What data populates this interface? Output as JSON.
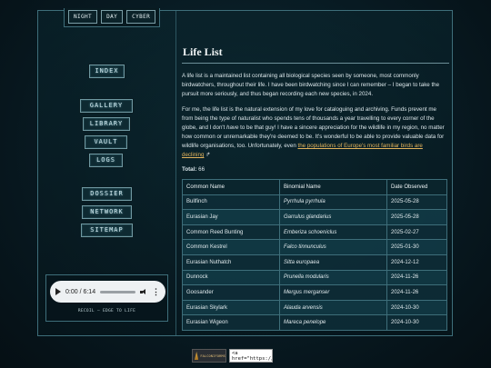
{
  "themes": [
    "NIGHT",
    "DAY",
    "CYBER"
  ],
  "nav": {
    "index": "INDEX",
    "gallery": "GALLERY",
    "library": "LIBRARY",
    "vault": "VAULT",
    "logs": "LOGS",
    "dossier": "DOSSIER",
    "network": "NETWORK",
    "sitemap": "SITEMAP"
  },
  "player": {
    "time": "0:00 / 6:14",
    "play_icon": "play-icon",
    "volume_icon": "volume-icon",
    "more_icon": "more-vertical-icon",
    "caption": "RECOIL — EDGE TO LIFE"
  },
  "main": {
    "title": "Life List",
    "para1": "A life list is a maintained list containing all biological species seen by someone, most commonly birdwatchers, throughout their life. I have been birdwatching since I can remember – I began to take the pursuit more seriously, and thus began recording each new species, in 2024.",
    "para2_a": "For me, the life list is the natural extension of my love for cataloguing and archiving. Funds prevent me from being the type of naturalist who spends tens of thousands a year travelling to every corner of the globe, and I don't ",
    "para2_em": "have",
    "para2_b": " to be that guy! I have a sincere appreciation for the wildlife in my region, no matter how common or unremarkable they're deemed to be. It's wonderful to be able to provide valuable data for wildlife organisations, too. Unfortunately, even ",
    "para2_link": "the populations of Europe's most familiar birds are declining",
    "para2_ext_icon": "external-link-icon",
    "total_label": "Total:",
    "total_value": "66"
  },
  "table": {
    "headers": [
      "Common Name",
      "Binomial Name",
      "Date Observed"
    ],
    "rows": [
      [
        "Bullfinch",
        "Pyrrhula pyrrhula",
        "2025-05-28"
      ],
      [
        "Eurasian Jay",
        "Garrulus glandarius",
        "2025-05-28"
      ],
      [
        "Common Reed Bunting",
        "Emberiza schoeniclus",
        "2025-02-27"
      ],
      [
        "Common Kestrel",
        "Falco tinnunculus",
        "2025-01-30"
      ],
      [
        "Eurasian Nuthatch",
        "Sitta europaea",
        "2024-12-12"
      ],
      [
        "Dunnock",
        "Prunella modularis",
        "2024-11-26"
      ],
      [
        "Goosander",
        "Mergus merganser",
        "2024-11-26"
      ],
      [
        "Eurasian Skylark",
        "Alauda arvensis",
        "2024-10-30"
      ],
      [
        "Eurasian Wigeon",
        "Mareca penelope",
        "2024-10-30"
      ]
    ]
  },
  "footer": {
    "badge_text": "FALCONIFORMS",
    "code_snippet": "<a href=\"https://falconi"
  },
  "colors": {
    "background": "#081a22",
    "border": "#3e6e7a",
    "link": "#e3b45c",
    "text": "#dbe6ea"
  }
}
